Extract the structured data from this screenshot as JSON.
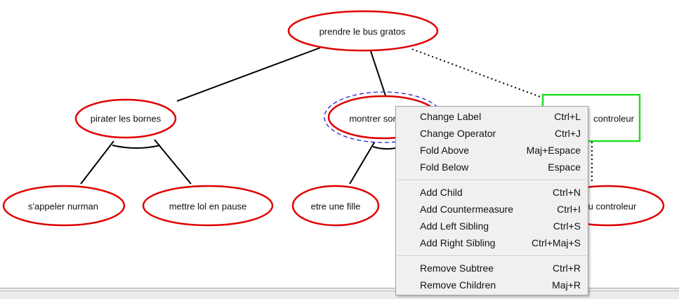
{
  "nodes": {
    "root": "prendre le bus gratos",
    "n1": "pirater les bornes",
    "n2": "montrer son",
    "n3": "controleur",
    "n11": "s'appeler nurman",
    "n12": "mettre lol en pause",
    "n21": "etre une fille",
    "n31": "u controleur"
  },
  "menu": {
    "items": [
      {
        "label": "Change Label",
        "shortcut": "Ctrl+L"
      },
      {
        "label": "Change Operator",
        "shortcut": "Ctrl+J"
      },
      {
        "label": "Fold Above",
        "shortcut": "Maj+Espace"
      },
      {
        "label": "Fold Below",
        "shortcut": "Espace"
      },
      {
        "label": "Add Child",
        "shortcut": "Ctrl+N"
      },
      {
        "label": "Add Countermeasure",
        "shortcut": "Ctrl+I"
      },
      {
        "label": "Add Left Sibling",
        "shortcut": "Ctrl+S"
      },
      {
        "label": "Add Right Sibling",
        "shortcut": "Ctrl+Maj+S"
      },
      {
        "label": "Remove Subtree",
        "shortcut": "Ctrl+R"
      },
      {
        "label": "Remove Children",
        "shortcut": "Maj+R"
      }
    ]
  },
  "colors": {
    "node_border": "#e00000",
    "countermeasure_border": "#22dd22",
    "selection": "#2020d0",
    "edge": "#000000"
  }
}
